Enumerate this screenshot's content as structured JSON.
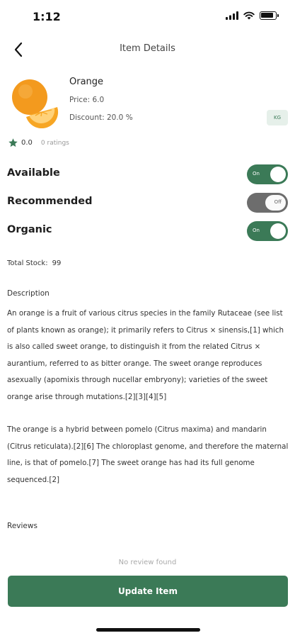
{
  "status_bar": {
    "time": "1:12"
  },
  "header": {
    "title": "Item Details"
  },
  "product": {
    "name": "Orange",
    "price": "Price: 6.0",
    "discount": "Discount: 20.0 %",
    "unit": "KG"
  },
  "rating": {
    "value": "0.0",
    "count": "0 ratings"
  },
  "toggles": [
    {
      "label": "Available",
      "state": "On"
    },
    {
      "label": "Recommended",
      "state": "Off"
    },
    {
      "label": "Organic",
      "state": "On"
    }
  ],
  "stock": {
    "label": "Total Stock:",
    "value": "99"
  },
  "description": {
    "title": "Description",
    "paragraph_1": "An orange is a fruit of various citrus species in the family Rutaceae (see list of plants known as orange); it primarily refers to Citrus × sinensis,[1] which is also called sweet orange, to distinguish it from the related Citrus × aurantium, referred to as bitter orange. The sweet orange reproduces asexually (apomixis through nucellar embryony); varieties of the sweet orange arise through mutations.[2][3][4][5]",
    "paragraph_2": "The orange is a hybrid between pomelo (Citrus maxima) and mandarin (Citrus reticulata).[2][6] The chloroplast genome, and therefore the maternal line, is that of pomelo.[7] The sweet orange has had its full genome sequenced.[2]"
  },
  "reviews": {
    "title": "Reviews",
    "empty_text": "No review found"
  },
  "actions": {
    "update_label": "Update Item"
  },
  "colors": {
    "accent": "#3b7a57",
    "toggle_off": "#6d6d6d",
    "badge_bg": "#e6f0ea"
  },
  "icons": [
    "signal-icon",
    "wifi-icon",
    "battery-icon",
    "back-arrow-icon",
    "star-icon"
  ]
}
